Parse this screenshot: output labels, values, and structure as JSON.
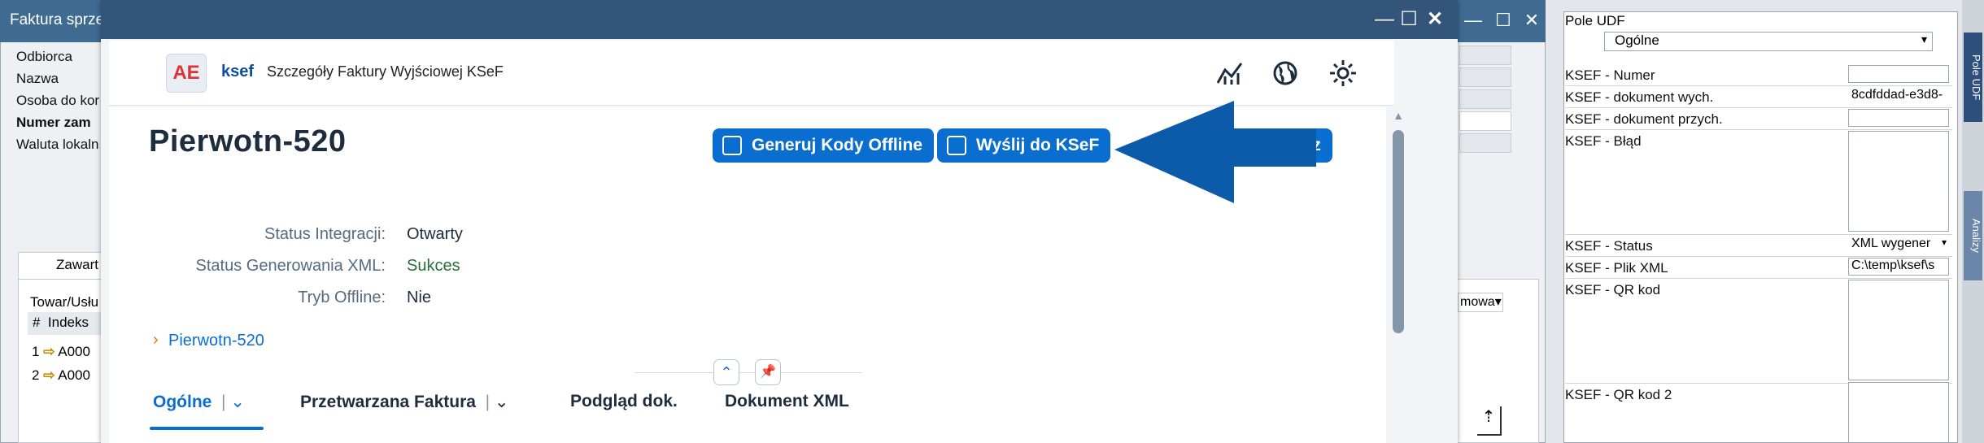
{
  "background_window": {
    "title": "Faktura sprze",
    "labels": [
      "Odbiorca",
      "Nazwa",
      "Osoba do kor",
      "Numer zam",
      "Waluta lokaln"
    ],
    "tab_label": "Zawart",
    "table_caption": "Towar/Usłu",
    "table_header_hash": "#",
    "table_header_index": "Indeks",
    "rows": [
      {
        "num": "1",
        "code": "A000"
      },
      {
        "num": "2",
        "code": "A000"
      }
    ],
    "dropdown_text": "mowa"
  },
  "udf_panel": {
    "title": "Pole UDF",
    "category": "Ogólne",
    "fields": [
      {
        "label": "KSEF - Numer",
        "value": ""
      },
      {
        "label": "KSEF - dokument wych.",
        "value": "8cdfddad-e3d8-"
      },
      {
        "label": "KSEF - dokument przych.",
        "value": ""
      },
      {
        "label": "KSEF - Błąd",
        "value": ""
      },
      {
        "label": "KSEF - Status",
        "value": "XML wygener"
      },
      {
        "label": "KSEF - Plik XML",
        "value": "C:\\temp\\ksef\\s"
      },
      {
        "label": "KSEF -  QR kod",
        "value": ""
      },
      {
        "label": "KSEF -  QR kod 2",
        "value": ""
      }
    ],
    "side_tabs": [
      "Pole UDF",
      "Analizy"
    ]
  },
  "dialog": {
    "app_logo": "AE",
    "app_name": "ksef",
    "app_title": "Szczegóły Faktury Wyjściowej KSeF",
    "object_title": "Pierwotn-520",
    "actions": {
      "generate_offline": "Generuj Kody Offline",
      "send_ksef": "Wyślij do KSeF",
      "partial": "ecz"
    },
    "attributes": [
      {
        "label": "Status Integracji:",
        "value": "Otwarty"
      },
      {
        "label": "Status Generowania XML:",
        "value": "Sukces"
      },
      {
        "label": "Tryb Offline:",
        "value": "Nie"
      }
    ],
    "breadcrumb": "Pierwotn-520",
    "tabs": [
      "Ogólne",
      "Przetwarzana Faktura",
      "Podgląd dok.",
      "Dokument XML"
    ],
    "colors": {
      "accent": "#0a6ed1",
      "success": "#256f3a",
      "arrow": "#0b5ba8"
    }
  }
}
